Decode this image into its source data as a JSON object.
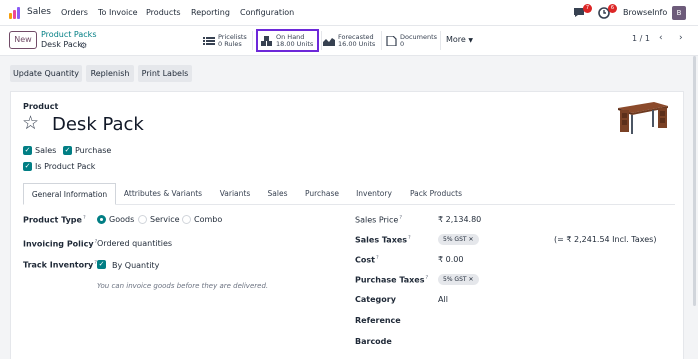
{
  "app": {
    "name": "Sales"
  },
  "menu": [
    "Orders",
    "To Invoice",
    "Products",
    "Reporting",
    "Configuration"
  ],
  "systray": {
    "messages_count": "7",
    "activity_count": "6",
    "company": "BrowseInfo",
    "avatar_initial": "B"
  },
  "control": {
    "new_label": "New",
    "breadcrumb_parent": "Product Packs",
    "breadcrumb_current": "Desk Pack",
    "stats": [
      {
        "label": "Pricelists",
        "value": "0 Rules"
      },
      {
        "label": "On Hand",
        "value": "18.00 Units"
      },
      {
        "label": "Forecasted",
        "value": "16.00 Units"
      },
      {
        "label": "Documents",
        "value": "0"
      }
    ],
    "more_label": "More",
    "pager": "1 / 1"
  },
  "actions": [
    "Update Quantity",
    "Replenish",
    "Print Labels"
  ],
  "product": {
    "label": "Product",
    "name": "Desk Pack",
    "flags": [
      {
        "label": "Sales",
        "checked": true
      },
      {
        "label": "Purchase",
        "checked": true
      },
      {
        "label": "Is Product Pack",
        "checked": true
      }
    ]
  },
  "tabs": [
    "General Information",
    "Attributes & Variants",
    "Variants",
    "Sales",
    "Purchase",
    "Inventory",
    "Pack Products"
  ],
  "left_fields": {
    "product_type_label": "Product Type",
    "product_type_options": [
      "Goods",
      "Service",
      "Combo"
    ],
    "product_type_selected": "Goods",
    "invoicing_policy_label": "Invoicing Policy",
    "invoicing_policy_value": "Ordered quantities",
    "track_inventory_label": "Track Inventory",
    "track_inventory_value": "By Quantity",
    "hint": "You can invoice goods before they are delivered."
  },
  "right_fields": {
    "sales_price_label": "Sales Price",
    "sales_price_value": "₹ 2,134.80",
    "sales_taxes_label": "Sales Taxes",
    "sales_taxes_tag": "5% GST",
    "incl_taxes": "(= ₹ 2,241.54 Incl. Taxes)",
    "cost_label": "Cost",
    "cost_value": "₹ 0.00",
    "purchase_taxes_label": "Purchase Taxes",
    "purchase_taxes_tag": "5% GST",
    "category_label": "Category",
    "category_value": "All",
    "reference_label": "Reference",
    "barcode_label": "Barcode"
  },
  "colors": {
    "brand": "#714b67",
    "accent": "#017e84",
    "highlight": "#6d28d9"
  }
}
